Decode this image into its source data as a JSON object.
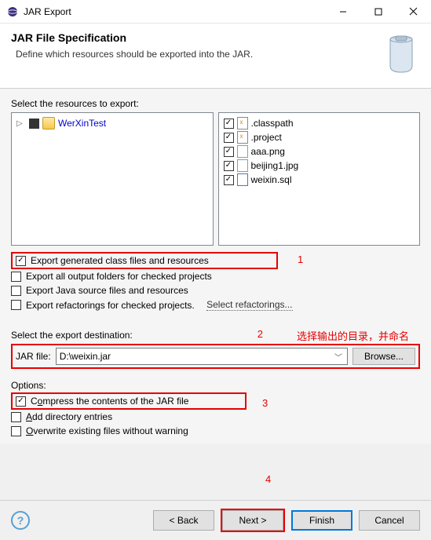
{
  "window": {
    "title": "JAR Export"
  },
  "header": {
    "title": "JAR File Specification",
    "subtitle": "Define which resources should be exported into the JAR."
  },
  "resources": {
    "label": "Select the resources to export:",
    "projects": [
      {
        "name": "WerXinTest"
      }
    ],
    "files": [
      {
        "name": ".classpath",
        "kind": "x"
      },
      {
        "name": ".project",
        "kind": "x"
      },
      {
        "name": "aaa.png",
        "kind": "img"
      },
      {
        "name": "beijing1.jpg",
        "kind": "img"
      },
      {
        "name": "weixin.sql",
        "kind": "sql"
      }
    ]
  },
  "exportOptions": {
    "generated": "Export generated class files and resources",
    "allOutput": "Export all output folders for checked projects",
    "javaSource": "Export Java source files and resources",
    "refactorings": "Export refactorings for checked projects.",
    "refactoringsLink": "Select refactorings..."
  },
  "destination": {
    "label": "Select the export destination:",
    "fieldLabel": "JAR file:",
    "value": "D:\\weixin.jar",
    "browse": "Browse..."
  },
  "options": {
    "groupLabel": "Options:",
    "compress": "Compress the contents of the JAR file",
    "addDir": "Add directory entries",
    "overwrite": "Overwrite existing files without warning"
  },
  "annotations": {
    "n1": "1",
    "n2": "2",
    "n2text": "选择输出的目录，并命名",
    "n3": "3",
    "n4": "4"
  },
  "footer": {
    "back": "< Back",
    "next": "Next >",
    "finish": "Finish",
    "cancel": "Cancel"
  }
}
